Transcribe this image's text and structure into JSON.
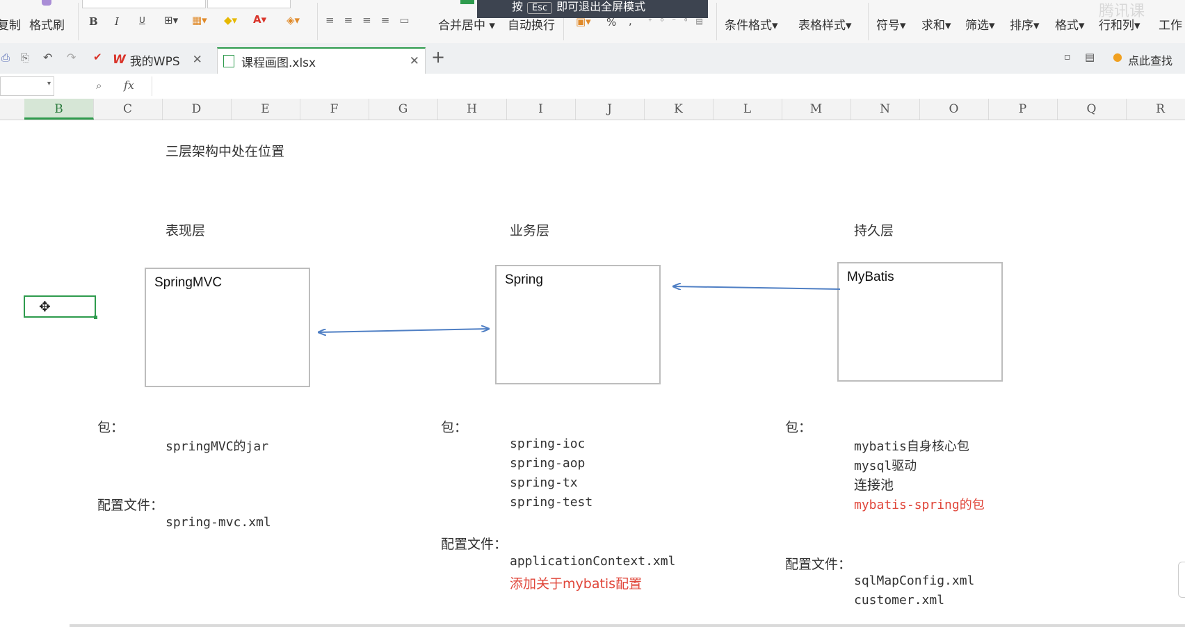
{
  "ribbon": {
    "copy": "复制",
    "format_painter": "格式刷",
    "bold": "B",
    "italic": "I",
    "underline": "U",
    "merge_center": "合并居中",
    "wrap_text": "自动换行",
    "percent": "%",
    "comma": ",",
    "cond_format": "条件格式",
    "table_style": "表格样式",
    "symbol": "符号",
    "sum": "求和",
    "filter": "筛选",
    "sort": "排序",
    "format": "格式",
    "row_col": "行和列",
    "worksheet": "工作",
    "esc_prefix": "按",
    "esc_key": "Esc",
    "esc_suffix": "即可退出全屏模式",
    "watermark": "腾讯课"
  },
  "tabs": {
    "wps": "我的WPS",
    "file": "课程画图.xlsx",
    "help": "点此查找"
  },
  "formula": {
    "fx": "fx",
    "value": ""
  },
  "columns": [
    "B",
    "C",
    "D",
    "E",
    "F",
    "G",
    "H",
    "I",
    "J",
    "K",
    "L",
    "M",
    "N",
    "O",
    "P",
    "Q",
    "R"
  ],
  "selected_column": "B",
  "sheet": {
    "title": "三层架构中处在位置",
    "layers": [
      {
        "name": "表现层",
        "box": "SpringMVC"
      },
      {
        "name": "业务层",
        "box": "Spring"
      },
      {
        "name": "持久层",
        "box": "MyBatis"
      }
    ],
    "col1": {
      "pkg_label": "包：",
      "pkg_items": [
        "springMVC的jar"
      ],
      "cfg_label": "配置文件：",
      "cfg_items": [
        "spring-mvc.xml"
      ]
    },
    "col2": {
      "pkg_label": "包：",
      "pkg_items": [
        "spring-ioc",
        "spring-aop",
        "spring-tx",
        "spring-test"
      ],
      "cfg_label": "配置文件：",
      "cfg_items": [
        "applicationContext.xml"
      ],
      "cfg_highlight": "添加关于mybatis配置"
    },
    "col3": {
      "pkg_label": "包：",
      "pkg_items": [
        "mybatis自身核心包",
        "mysql驱动",
        "连接池"
      ],
      "pkg_highlight": "mybatis-spring的包",
      "cfg_label": "配置文件：",
      "cfg_items": [
        "sqlMapConfig.xml",
        "customer.xml"
      ]
    }
  },
  "colors": {
    "accent_green": "#2e9b4d",
    "arrow_blue": "#4f7fc4",
    "highlight_red": "#e0463a",
    "wps_red": "#d9352b"
  }
}
